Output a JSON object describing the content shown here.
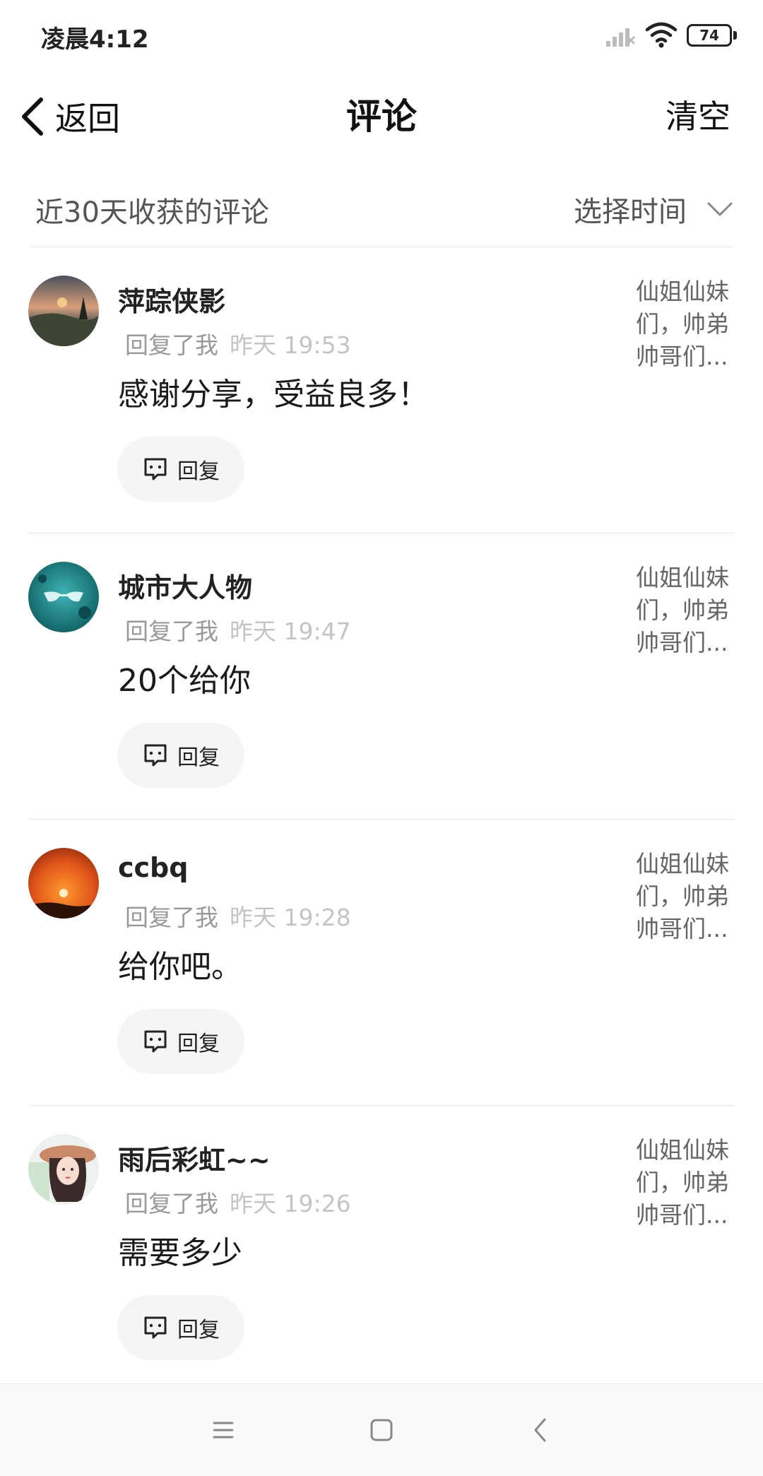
{
  "status_bar": {
    "time": "凌晨4:12",
    "battery": "74",
    "icons": [
      "signal-icon",
      "wifi-icon",
      "battery-icon"
    ]
  },
  "nav": {
    "back_label": "返回",
    "title": "评论",
    "clear_label": "清空"
  },
  "filter": {
    "label": "近30天收获的评论",
    "time_select": "选择时间"
  },
  "comments": [
    {
      "name": "萍踪侠影",
      "action": "回复了我",
      "time": "昨天 19:53",
      "text": "感谢分享，受益良多！",
      "reply_label": "回复",
      "source": [
        "仙姐仙妹",
        "们，帅弟",
        "帅哥们..."
      ]
    },
    {
      "name": "城市大人物",
      "action": "回复了我",
      "time": "昨天 19:47",
      "text": "20个给你",
      "reply_label": "回复",
      "source": [
        "仙姐仙妹",
        "们，帅弟",
        "帅哥们..."
      ]
    },
    {
      "name": "ccbq",
      "action": "回复了我",
      "time": "昨天 19:28",
      "text": "给你吧。",
      "reply_label": "回复",
      "source": [
        "仙姐仙妹",
        "们，帅弟",
        "帅哥们..."
      ]
    },
    {
      "name": "雨后彩虹~~",
      "action": "回复了我",
      "time": "昨天 19:26",
      "text": "需要多少",
      "reply_label": "回复",
      "source": [
        "仙姐仙妹",
        "们，帅弟",
        "帅哥们..."
      ]
    }
  ],
  "system_nav": {
    "icons": [
      "menu-icon",
      "home-icon",
      "back-icon"
    ]
  }
}
